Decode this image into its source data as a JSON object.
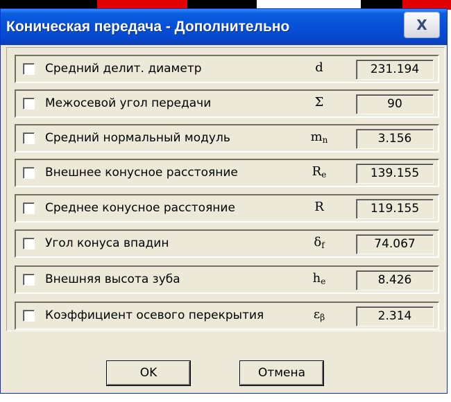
{
  "window": {
    "title": "Коническая передача - Дополнительно",
    "close_label": "X"
  },
  "rows": [
    {
      "label": "Средний делит. диаметр",
      "symbol": "d",
      "subscript": "",
      "value": "231.194",
      "checked": false
    },
    {
      "label": "Межосевой угол передачи",
      "symbol": "Σ",
      "subscript": "",
      "value": "90",
      "checked": false
    },
    {
      "label": "Средний нормальный модуль",
      "symbol": "m",
      "subscript": "n",
      "value": "3.156",
      "checked": false
    },
    {
      "label": "Внешнее конусное расстояние",
      "symbol": "R",
      "subscript": "e",
      "value": "139.155",
      "checked": false
    },
    {
      "label": "Среднее конусное расстояние",
      "symbol": "R",
      "subscript": "",
      "value": "119.155",
      "checked": false
    },
    {
      "label": "Угол конуса впадин",
      "symbol": "δ",
      "subscript": "f",
      "value": "74.067",
      "checked": false
    },
    {
      "label": "Внешняя высота зуба",
      "symbol": "h",
      "subscript": "e",
      "value": "8.426",
      "checked": false
    },
    {
      "label": "Коэффициент осевого перекрытия",
      "symbol": "ε",
      "subscript": "β",
      "value": "2.314",
      "checked": false
    }
  ],
  "buttons": {
    "ok_label": "OK",
    "cancel_label": "Отмена"
  },
  "colors": {
    "titlebar": "#0752d8",
    "dialog_background": "#ece9d8"
  }
}
